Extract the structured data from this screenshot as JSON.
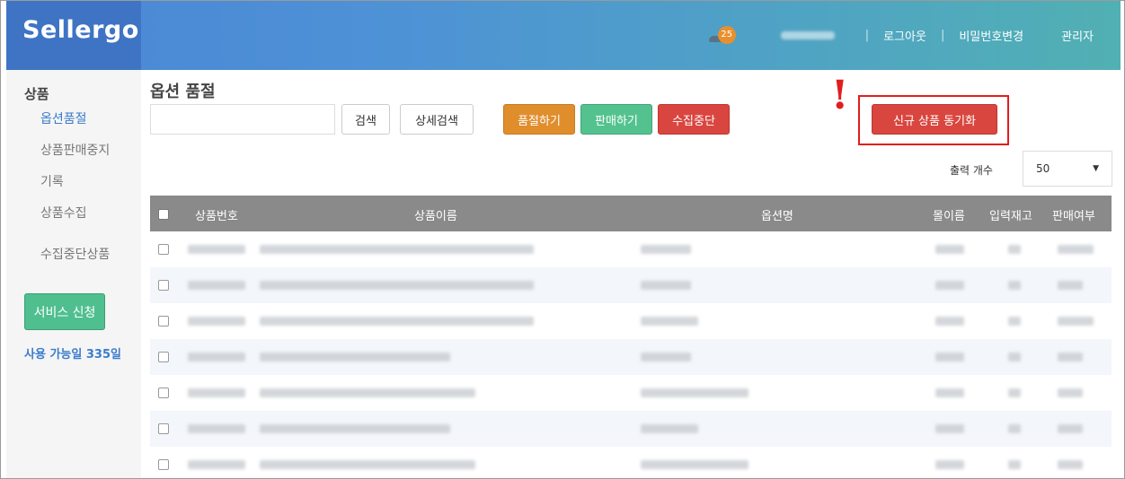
{
  "header": {
    "logo": "Sellergo",
    "notification_count": "25",
    "logout": "로그아웃",
    "change_password": "비밀번호변경",
    "admin": "관리자",
    "colors": {
      "gradient_start": "#4a86d6",
      "gradient_end": "#51b0b3",
      "logo_bg": "#3f74c4",
      "badge": "#e8902e"
    }
  },
  "sidebar": {
    "section_title": "상품",
    "items": [
      {
        "label": "옵션품절",
        "active": true
      },
      {
        "label": "상품판매중지",
        "active": false
      },
      {
        "label": "기록",
        "active": false
      },
      {
        "label": "상품수집",
        "active": false
      },
      {
        "label": "수집중단상품",
        "active": false
      }
    ],
    "service_button": "서비스 신청",
    "available_days": "사용 가능일 335일"
  },
  "main": {
    "title": "옵션 품절",
    "search": {
      "value": "",
      "placeholder": ""
    },
    "buttons": {
      "search": "검색",
      "advanced_search": "상세검색",
      "soldout": "품절하기",
      "sell": "판매하기",
      "stop_collect": "수집중단",
      "sync_new": "신규 상품 동기화"
    },
    "output_count_label": "출력 개수",
    "output_count_value": "50",
    "table": {
      "columns": [
        "상품번호",
        "상품이름",
        "옵션명",
        "몰이름",
        "입력재고",
        "판매여부"
      ],
      "row_count": 7
    }
  }
}
